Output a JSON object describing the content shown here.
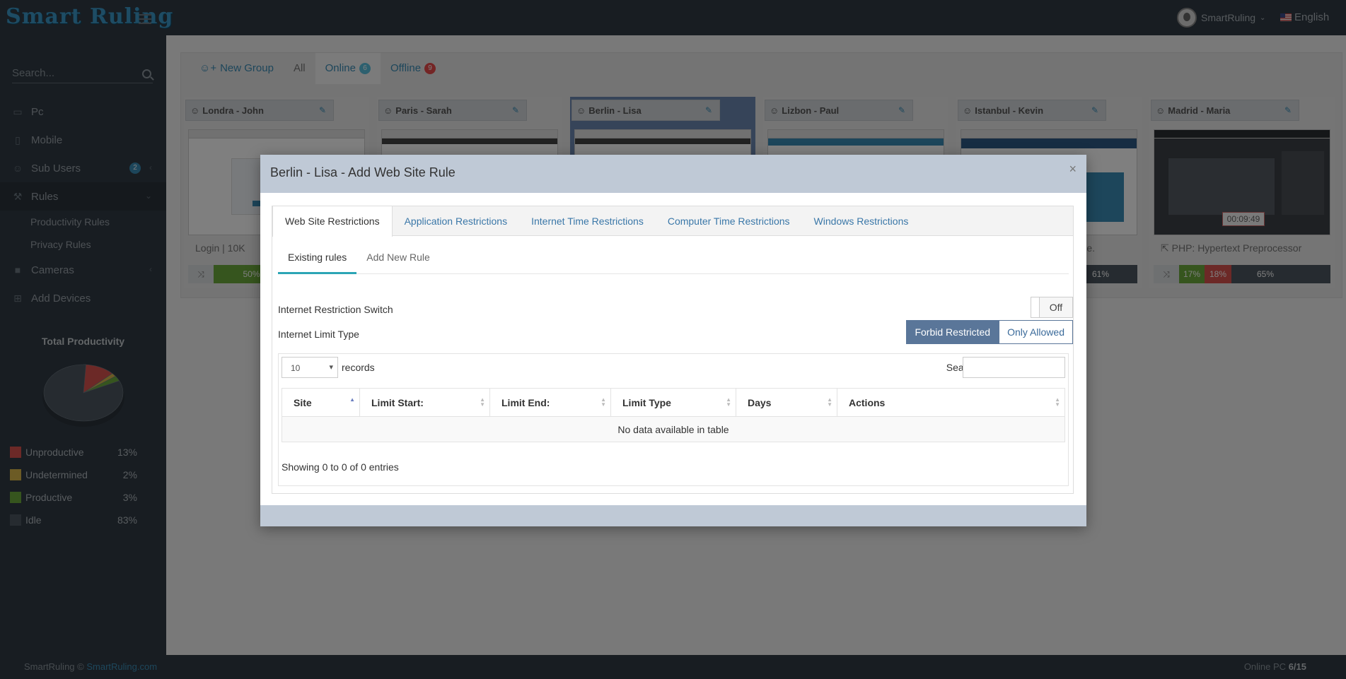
{
  "app": {
    "logo": "Smart Ruling",
    "user_name": "SmartRuling",
    "language": "English"
  },
  "sidebar": {
    "search_placeholder": "Search...",
    "items": [
      {
        "label": "Pc",
        "icon": "monitor-icon"
      },
      {
        "label": "Mobile",
        "icon": "mobile-icon"
      },
      {
        "label": "Sub Users",
        "icon": "user-icon",
        "badge": "2"
      },
      {
        "label": "Rules",
        "icon": "gavel-icon"
      },
      {
        "label": "Cameras",
        "icon": "camera-icon"
      },
      {
        "label": "Add Devices",
        "icon": "plus-square-icon"
      }
    ],
    "sub_items": [
      "Productivity Rules",
      "Privacy Rules"
    ],
    "productivity_title": "Total Productivity",
    "legend": [
      {
        "name": "Unproductive",
        "value": "13%",
        "color": "#d9534f",
        "fraction": 0.13
      },
      {
        "name": "Undetermined",
        "value": "2%",
        "color": "#d8b74a",
        "fraction": 0.02
      },
      {
        "name": "Productive",
        "value": "3%",
        "color": "#6cab3c",
        "fraction": 0.03
      },
      {
        "name": "Idle",
        "value": "83%",
        "color": "#4d5760",
        "fraction": 0.83
      }
    ]
  },
  "groups": {
    "new_group": "New Group",
    "all": "All",
    "online": "Online",
    "online_count": "6",
    "offline": "Offline",
    "offline_count": "9"
  },
  "cards": [
    {
      "name": "Londra - John",
      "title": "Login | 10K",
      "prog": [
        {
          "label": "50%",
          "color": "#6cab3c",
          "fraction": 0.5
        }
      ]
    },
    {
      "name": "Paris - Sarah",
      "title": "",
      "prog": []
    },
    {
      "name": "Berlin - Lisa",
      "title": "",
      "prog": []
    },
    {
      "name": "Lizbon - Paul",
      "title": "",
      "prog": []
    },
    {
      "name": "Istanbul - Kevin",
      "title": "me.",
      "prog": [
        {
          "label": "61%",
          "color": "#4d5760",
          "fraction": 0.9
        }
      ]
    },
    {
      "name": "Madrid - Maria",
      "title": "PHP: Hypertext Preprocessor",
      "time": "00:09:49",
      "prog": [
        {
          "label": "17%",
          "color": "#6cab3c",
          "fraction": 0.17
        },
        {
          "label": "18%",
          "color": "#d9534f",
          "fraction": 0.18
        },
        {
          "label": "65%",
          "color": "#4d5760",
          "fraction": 0.65
        }
      ]
    }
  ],
  "modal": {
    "title": "Berlin - Lisa - Add Web Site Rule",
    "close": "×",
    "outer_tabs": [
      "Web Site Restrictions",
      "Application Restrictions",
      "Internet Time Restrictions",
      "Computer Time Restrictions",
      "Windows Restrictions"
    ],
    "inner_tabs": [
      "Existing rules",
      "Add New Rule"
    ],
    "switch_label": "Internet Restriction Switch",
    "switch_state": "Off",
    "limit_label": "Internet Limit Type",
    "limit_options": [
      "Forbid Restricted",
      "Only Allowed"
    ],
    "page_length": "10",
    "records_label": "records",
    "search_label": "Search:",
    "columns": [
      "Site",
      "Limit Start:",
      "Limit End:",
      "Limit Type",
      "Days",
      "Actions"
    ],
    "empty_text": "No data available in table",
    "showing": "Showing 0 to 0 of 0 entries"
  },
  "footer": {
    "copyright": "SmartRuling ©",
    "link": "SmartRuling.com",
    "online_label": "Online PC",
    "online_value": "6/15"
  }
}
